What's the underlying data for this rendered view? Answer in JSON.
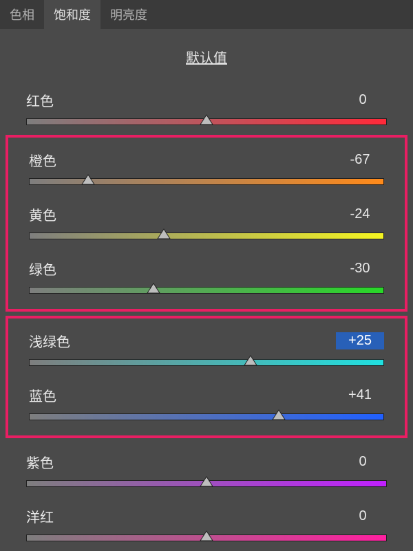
{
  "tabs": {
    "hue": "色相",
    "saturation": "饱和度",
    "luminance": "明亮度",
    "active": "saturation"
  },
  "default_link": "默认值",
  "sliders": {
    "red": {
      "label": "红色",
      "value": "0",
      "pos": 50.0
    },
    "orange": {
      "label": "橙色",
      "value": "-67",
      "pos": 16.5
    },
    "yellow": {
      "label": "黄色",
      "value": "-24",
      "pos": 38.0
    },
    "green": {
      "label": "绿色",
      "value": "-30",
      "pos": 35.0
    },
    "aqua": {
      "label": "浅绿色",
      "value": "+25",
      "pos": 62.5
    },
    "blue": {
      "label": "蓝色",
      "value": "+41",
      "pos": 70.5
    },
    "purple": {
      "label": "紫色",
      "value": "0",
      "pos": 50.0
    },
    "magenta": {
      "label": "洋红",
      "value": "0",
      "pos": 50.0
    }
  },
  "highlight_group_1": [
    "orange",
    "yellow",
    "green"
  ],
  "highlight_group_2": [
    "aqua",
    "blue"
  ],
  "selected_value_field": "aqua"
}
